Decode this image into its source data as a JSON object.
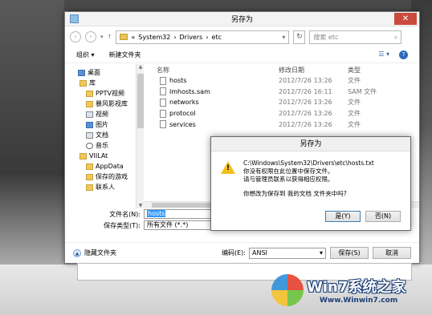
{
  "dialog": {
    "title": "另存为",
    "close_label": "✕"
  },
  "nav": {
    "path": [
      "«",
      "System32",
      "›",
      "Drivers",
      "›",
      "etc"
    ],
    "search_placeholder": "搜索 etc"
  },
  "toolbar": {
    "organize_label": "组织 ▾",
    "new_folder_label": "新建文件夹"
  },
  "tree": {
    "items": [
      {
        "label": "桌面",
        "icon": "desktop-icon"
      },
      {
        "label": "库",
        "icon": "library-icon"
      },
      {
        "label": "PPTV视频",
        "icon": "folder-icon"
      },
      {
        "label": "暴风影视库",
        "icon": "folder-icon"
      },
      {
        "label": "视频",
        "icon": "video-icon"
      },
      {
        "label": "图片",
        "icon": "picture-icon"
      },
      {
        "label": "文档",
        "icon": "document-icon"
      },
      {
        "label": "音乐",
        "icon": "music-icon"
      },
      {
        "label": "VIILAt",
        "icon": "user-icon"
      },
      {
        "label": "AppData",
        "icon": "folder-icon"
      },
      {
        "label": "保存的游戏",
        "icon": "folder-icon"
      },
      {
        "label": "联系人",
        "icon": "contacts-icon"
      }
    ]
  },
  "files": {
    "columns": {
      "name": "名称",
      "date": "修改日期",
      "type": "类型"
    },
    "rows": [
      {
        "name": "hosts",
        "date": "2012/7/26 13:26",
        "type": "文件"
      },
      {
        "name": "lmhosts.sam",
        "date": "2012/7/26 16:11",
        "type": "SAM 文件"
      },
      {
        "name": "networks",
        "date": "2012/7/26 13:26",
        "type": "文件"
      },
      {
        "name": "protocol",
        "date": "2012/7/26 13:26",
        "type": "文件"
      },
      {
        "name": "services",
        "date": "2012/7/26 13:26",
        "type": "文件"
      }
    ]
  },
  "form": {
    "filename_label": "文件名(N):",
    "filename_value": "hosts",
    "filetype_label": "保存类型(T):",
    "filetype_value": "所有文件 (*.*)"
  },
  "footer": {
    "hide_folders_label": "隐藏文件夹",
    "encoding_label": "编码(E):",
    "encoding_value": "ANSI",
    "save_label": "保存(S)",
    "cancel_label": "取消"
  },
  "modal": {
    "title": "另存为",
    "path": "C:\\Windows\\System32\\Drivers\\etc\\hosts.txt",
    "line1": "你没有权限在此位置中保存文件。",
    "line2": "请与管理员联系以获得相应权限。",
    "question": "你想改为保存到 我的文档 文件夹中吗?",
    "yes_label": "是(Y)",
    "no_label": "否(N)"
  },
  "watermark": {
    "title": "Win7系统之家",
    "url": "Www.Winwin7.com"
  }
}
